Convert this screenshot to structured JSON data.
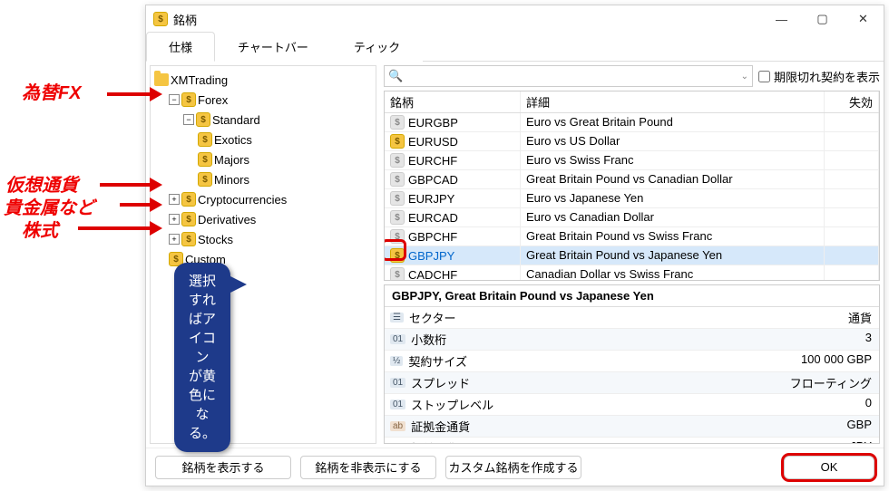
{
  "window": {
    "title": "銘柄"
  },
  "tabs": {
    "spec": "仕様",
    "chart": "チャートバー",
    "tick": "ティック"
  },
  "tree": {
    "root": "XMTrading",
    "forex": "Forex",
    "standard": "Standard",
    "exotics": "Exotics",
    "majors": "Majors",
    "minors": "Minors",
    "crypto": "Cryptocurrencies",
    "deriv": "Derivatives",
    "stocks": "Stocks",
    "custom": "Custom"
  },
  "search": {
    "show_expired": "期限切れ契約を表示"
  },
  "grid": {
    "head_symbol": "銘柄",
    "head_detail": "詳細",
    "head_disabled": "失効",
    "rows": [
      {
        "sym": "EURGBP",
        "det": "Euro vs Great Britain Pound",
        "gold": false
      },
      {
        "sym": "EURUSD",
        "det": "Euro vs US Dollar",
        "gold": true
      },
      {
        "sym": "EURCHF",
        "det": "Euro vs Swiss Franc",
        "gold": false
      },
      {
        "sym": "GBPCAD",
        "det": "Great Britain Pound vs Canadian Dollar",
        "gold": false
      },
      {
        "sym": "EURJPY",
        "det": "Euro vs Japanese Yen",
        "gold": false
      },
      {
        "sym": "EURCAD",
        "det": "Euro vs Canadian Dollar",
        "gold": false
      },
      {
        "sym": "GBPCHF",
        "det": "Great Britain Pound vs Swiss Franc",
        "gold": false
      },
      {
        "sym": "GBPJPY",
        "det": "Great Britain Pound vs Japanese Yen",
        "gold": true,
        "selected": true
      },
      {
        "sym": "CADCHF",
        "det": "Canadian Dollar vs Swiss Franc",
        "gold": false
      }
    ]
  },
  "details": {
    "title": "GBPJPY, Great Britain Pound vs Japanese Yen",
    "rows": [
      {
        "tag": "☰",
        "label": "セクター",
        "value": "通貨"
      },
      {
        "tag": "01",
        "label": "小数桁",
        "value": "3"
      },
      {
        "tag": "½",
        "label": "契約サイズ",
        "value": "100 000 GBP"
      },
      {
        "tag": "01",
        "label": "スプレッド",
        "value": "フローティング"
      },
      {
        "tag": "01",
        "label": "ストップレベル",
        "value": "0"
      },
      {
        "tag": "ab",
        "label": "証拠金通貨",
        "value": "GBP"
      },
      {
        "tag": "ab",
        "label": "損益通貨",
        "value": "JPY"
      }
    ]
  },
  "footer": {
    "show": "銘柄を表示する",
    "hide": "銘柄を非表示にする",
    "custom": "カスタム銘柄を作成する",
    "ok": "OK"
  },
  "annotations": {
    "fx": "為替FX",
    "crypto": "仮想通貨",
    "metals": "貴金属など",
    "stocks": "株式",
    "callout1": "選択すればアイコン",
    "callout2": "が黄色になる。"
  }
}
